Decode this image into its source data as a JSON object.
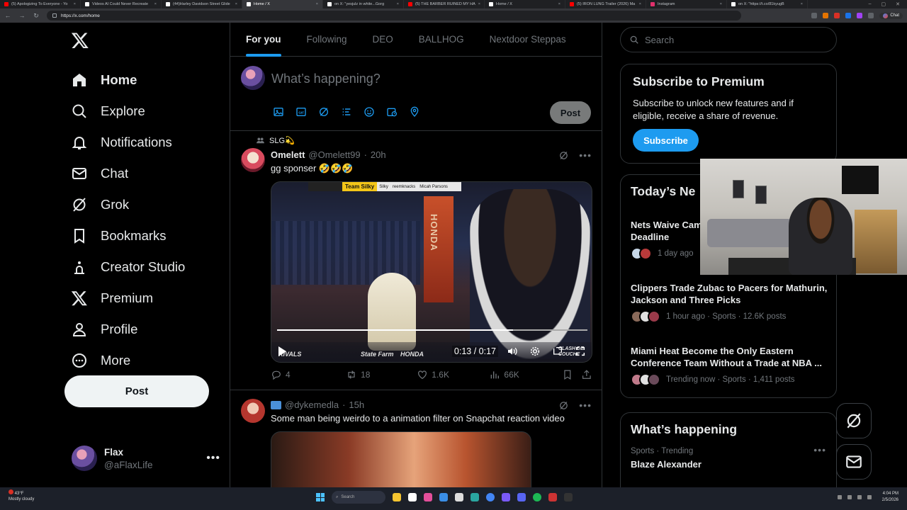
{
  "browser": {
    "tabs": [
      {
        "title": "(5) Apologizing To Everyone - Yo",
        "color": "#ff0000"
      },
      {
        "title": "Videos AI Could Never Recreate",
        "color": "#ffffff"
      },
      {
        "title": "(44)Harley Davidson Street Glide",
        "color": "#ffffff"
      },
      {
        "title": "Home / X",
        "color": "#ffffff",
        "active": true
      },
      {
        "title": "on X: \"yesjulz in white...Gorg",
        "color": "#ffffff"
      },
      {
        "title": "(5) THE BARBER RUINED MY HA",
        "color": "#ff0000"
      },
      {
        "title": "Home / X",
        "color": "#ffffff"
      },
      {
        "title": "(5) IRON LUNG Trailer (2026) Ma",
        "color": "#ff0000"
      },
      {
        "title": "Instagram",
        "color": "#e1306c"
      },
      {
        "title": "on X: \"https://t.co/81kyugB",
        "color": "#ffffff"
      }
    ],
    "url": "https://x.com/home",
    "chat_label": "Chat"
  },
  "sidebar": {
    "nav": [
      {
        "id": "home",
        "label": "Home",
        "icon": "home-icon",
        "active": true
      },
      {
        "id": "explore",
        "label": "Explore",
        "icon": "search-icon"
      },
      {
        "id": "notifications",
        "label": "Notifications",
        "icon": "bell-icon"
      },
      {
        "id": "chat",
        "label": "Chat",
        "icon": "mail-icon"
      },
      {
        "id": "grok",
        "label": "Grok",
        "icon": "grok-icon"
      },
      {
        "id": "bookmarks",
        "label": "Bookmarks",
        "icon": "bookmark-icon"
      },
      {
        "id": "creator",
        "label": "Creator Studio",
        "icon": "creator-studio-icon"
      },
      {
        "id": "premium",
        "label": "Premium",
        "icon": "x-logo-icon"
      },
      {
        "id": "profile",
        "label": "Profile",
        "icon": "person-icon"
      },
      {
        "id": "more",
        "label": "More",
        "icon": "more-circle-icon"
      }
    ],
    "post_label": "Post",
    "account": {
      "name": "Flax",
      "handle": "@aFlaxLife"
    }
  },
  "main": {
    "tabs": [
      "For you",
      "Following",
      "DEO",
      "BALLHOG",
      "Nextdoor Steppas"
    ],
    "composer": {
      "placeholder": "What’s happening?",
      "post_label": "Post"
    },
    "tweet1": {
      "context": "SLG💫",
      "name": "Omelett",
      "handle": "@Omelett99",
      "time": "20h",
      "text": "gg sponser 🤣🤣🤣",
      "video": {
        "banner_team": "Team Silky",
        "banner_names": [
          "Silky",
          "reemknacks",
          "Micah Parsons"
        ],
        "sign": "HONDA",
        "time": "0:13 / 0:17",
        "progress": 0.76,
        "brands": [
          "RIVALS",
          "State Farm",
          "HONDA",
          "CLASH DE COUCHE"
        ]
      },
      "replies": "4",
      "reposts": "18",
      "likes": "1.6K",
      "views": "66K"
    },
    "tweet2": {
      "handle": "@dykemedla",
      "time": "15h",
      "text": "Some man being weirdo to a animation filter on Snapchat  reaction video"
    }
  },
  "right": {
    "search_placeholder": "Search",
    "premium": {
      "title": "Subscribe to Premium",
      "text": "Subscribe to unlock new features and if eligible, receive a share of revenue.",
      "button": "Subscribe"
    },
    "news": {
      "title": "Today’s Ne",
      "items": [
        {
          "title": "Nets Waive Cam\nDeadline",
          "meta": "1 day ago"
        },
        {
          "title": "Clippers Trade Zubac to Pacers for Mathurin, Jackson and Three Picks",
          "meta": "1 hour ago · Sports · 12.6K posts"
        },
        {
          "title": "Miami Heat Become the Only Eastern Conference Team Without a Trade at NBA ...",
          "meta": "Trending now · Sports · 1,411 posts"
        }
      ]
    },
    "happening": {
      "title": "What’s happening",
      "category": "Sports · Trending",
      "topic": "Blaze Alexander"
    }
  },
  "taskbar": {
    "weather_temp": "43°F",
    "weather_desc": "Mostly cloudy",
    "search_label": "Search",
    "time": "4:04 PM",
    "date": "2/5/2026"
  }
}
